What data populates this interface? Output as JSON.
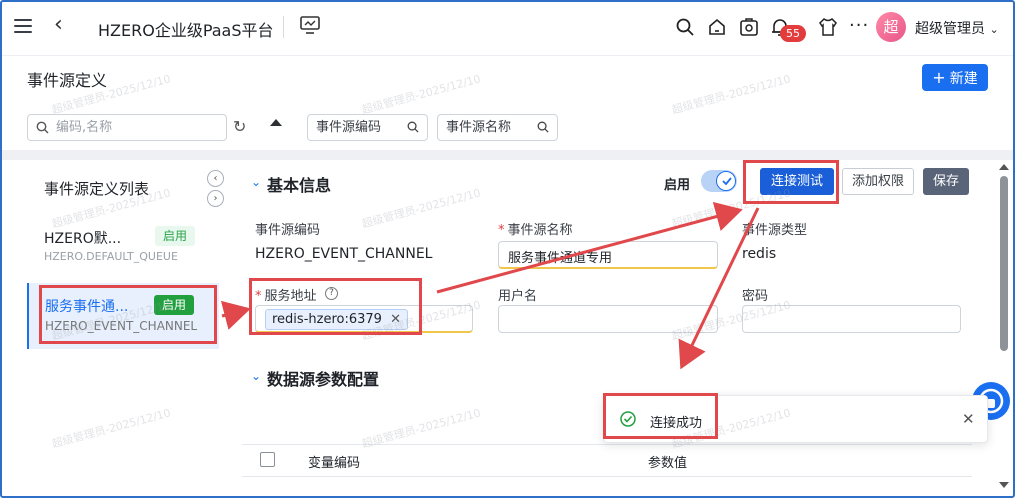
{
  "topbar": {
    "app_title": "HZERO企业级PaaS平台",
    "notification_count": "55",
    "avatar_text": "超",
    "user_name": "超级管理员"
  },
  "page": {
    "title": "事件源定义",
    "new_button": "新建",
    "search_placeholder": "编码,名称",
    "filter_code": "事件源编码",
    "filter_name": "事件源名称"
  },
  "list": {
    "title": "事件源定义列表",
    "items": [
      {
        "name": "HZERO默...",
        "code": "HZERO.DEFAULT_QUEUE",
        "status": "启用"
      },
      {
        "name": "服务事件通...",
        "code": "HZERO_EVENT_CHANNEL",
        "status": "启用"
      }
    ]
  },
  "basic": {
    "section_title": "基本信息",
    "enable_label": "启用",
    "test_button": "连接测试",
    "perm_button": "添加权限",
    "save_button": "保存",
    "code_label": "事件源编码",
    "code_value": "HZERO_EVENT_CHANNEL",
    "name_label": "事件源名称",
    "name_value": "服务事件通道专用",
    "type_label": "事件源类型",
    "type_value": "redis",
    "addr_label": "服务地址",
    "addr_value": "redis-hzero:6379",
    "user_label": "用户名",
    "user_value": "",
    "pwd_label": "密码",
    "pwd_value": ""
  },
  "params": {
    "section_title": "数据源参数配置",
    "col_code": "变量编码",
    "col_value": "参数值"
  },
  "toast": {
    "message": "连接成功"
  },
  "watermark": "超级管理员-2025/12/10",
  "colors": {
    "primary": "#1a6ef0",
    "annotation_red": "#e0484b",
    "success_green": "#22a03f"
  }
}
